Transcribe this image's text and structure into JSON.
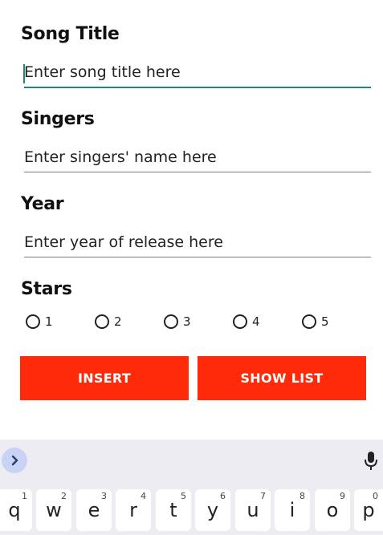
{
  "form": {
    "song_title_label": "Song Title",
    "song_title_placeholder": "Enter song title here",
    "singers_label": "Singers",
    "singers_placeholder": "Enter singers' name here",
    "year_label": "Year",
    "year_placeholder": "Enter year of release here",
    "stars_label": "Stars",
    "stars_options": [
      "1",
      "2",
      "3",
      "4",
      "5"
    ],
    "insert_label": "INSERT",
    "show_list_label": "SHOW LIST"
  },
  "keyboard": {
    "keys": [
      {
        "letter": "q",
        "hint": "1"
      },
      {
        "letter": "w",
        "hint": "2"
      },
      {
        "letter": "e",
        "hint": "3"
      },
      {
        "letter": "r",
        "hint": "4"
      },
      {
        "letter": "t",
        "hint": "5"
      },
      {
        "letter": "y",
        "hint": "6"
      },
      {
        "letter": "u",
        "hint": "7"
      },
      {
        "letter": "i",
        "hint": "8"
      },
      {
        "letter": "o",
        "hint": "9"
      },
      {
        "letter": "p",
        "hint": "0"
      }
    ]
  },
  "colors": {
    "accent": "#1a8a7a",
    "button": "#ff2a0a",
    "keyboard_bg": "#edecf2"
  },
  "icons": {
    "keyboard_toggle": "chevron-right-icon",
    "voice": "microphone-icon"
  }
}
